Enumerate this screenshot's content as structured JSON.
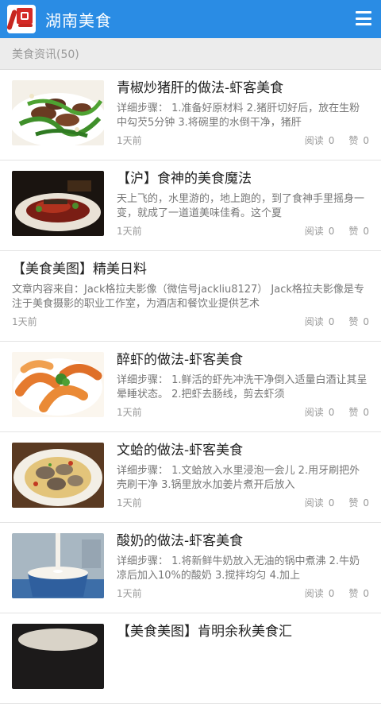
{
  "app": {
    "title": "湖南美食",
    "logo_icon": "hunan-food-logo-icon",
    "menu_icon": "hamburger-menu-icon",
    "theme_color": "#2a8ce4"
  },
  "section": {
    "title": "美食资讯(50)"
  },
  "labels": {
    "reads": "阅读",
    "likes": "赞"
  },
  "articles": [
    {
      "title": "青椒炒猪肝的做法-虾客美食",
      "desc": "详细步骤：  1.准备好原材料 2.猪肝切好后，放在生粉中勾芡5分钟 3.将碗里的水倒干净，猪肝",
      "time": "1天前",
      "reads": "0",
      "likes": "0",
      "image": "stir-fried-liver-photo"
    },
    {
      "title": "【沪】食神的美食魔法",
      "desc": "天上飞的，水里游的，地上跑的，到了食神手里摇身一变，就成了一道道美味佳肴。这个夏",
      "time": "1天前",
      "reads": "0",
      "likes": "0",
      "image": "plated-dish-photo"
    },
    {
      "title": "【美食美图】精美日料",
      "desc": "文章内容来自：Jack格拉夫影像（微信号jackliu8127） Jack格拉夫影像是专注于美食摄影的职业工作室，为酒店和餐饮业提供艺术",
      "time": "1天前",
      "reads": "0",
      "likes": "0",
      "image": null
    },
    {
      "title": "醉虾的做法-虾客美食",
      "desc": "详细步骤：  1.鲜活的虾先冲洗干净倒入适量白酒让其呈晕睡状态。 2.把虾去肠线，剪去虾须",
      "time": "1天前",
      "reads": "0",
      "likes": "0",
      "image": "drunken-shrimp-photo"
    },
    {
      "title": "文蛤的做法-虾客美食",
      "desc": "详细步骤：  1.文蛤放入水里浸泡一会儿 2.用牙刷把外壳刷干净 3.锅里放水加姜片煮开后放入",
      "time": "1天前",
      "reads": "0",
      "likes": "0",
      "image": "clams-photo"
    },
    {
      "title": "酸奶的做法-虾客美食",
      "desc": "详细步骤：  1.将新鲜牛奶放入无油的锅中煮沸 2.牛奶凉后加入10%的酸奶 3.搅拌均匀 4.加上",
      "time": "1天前",
      "reads": "0",
      "likes": "0",
      "image": "yogurt-photo"
    },
    {
      "title": "【美食美图】肯明余秋美食汇",
      "desc": "",
      "time": "",
      "reads": "",
      "likes": "",
      "image": "partial-photo"
    }
  ]
}
